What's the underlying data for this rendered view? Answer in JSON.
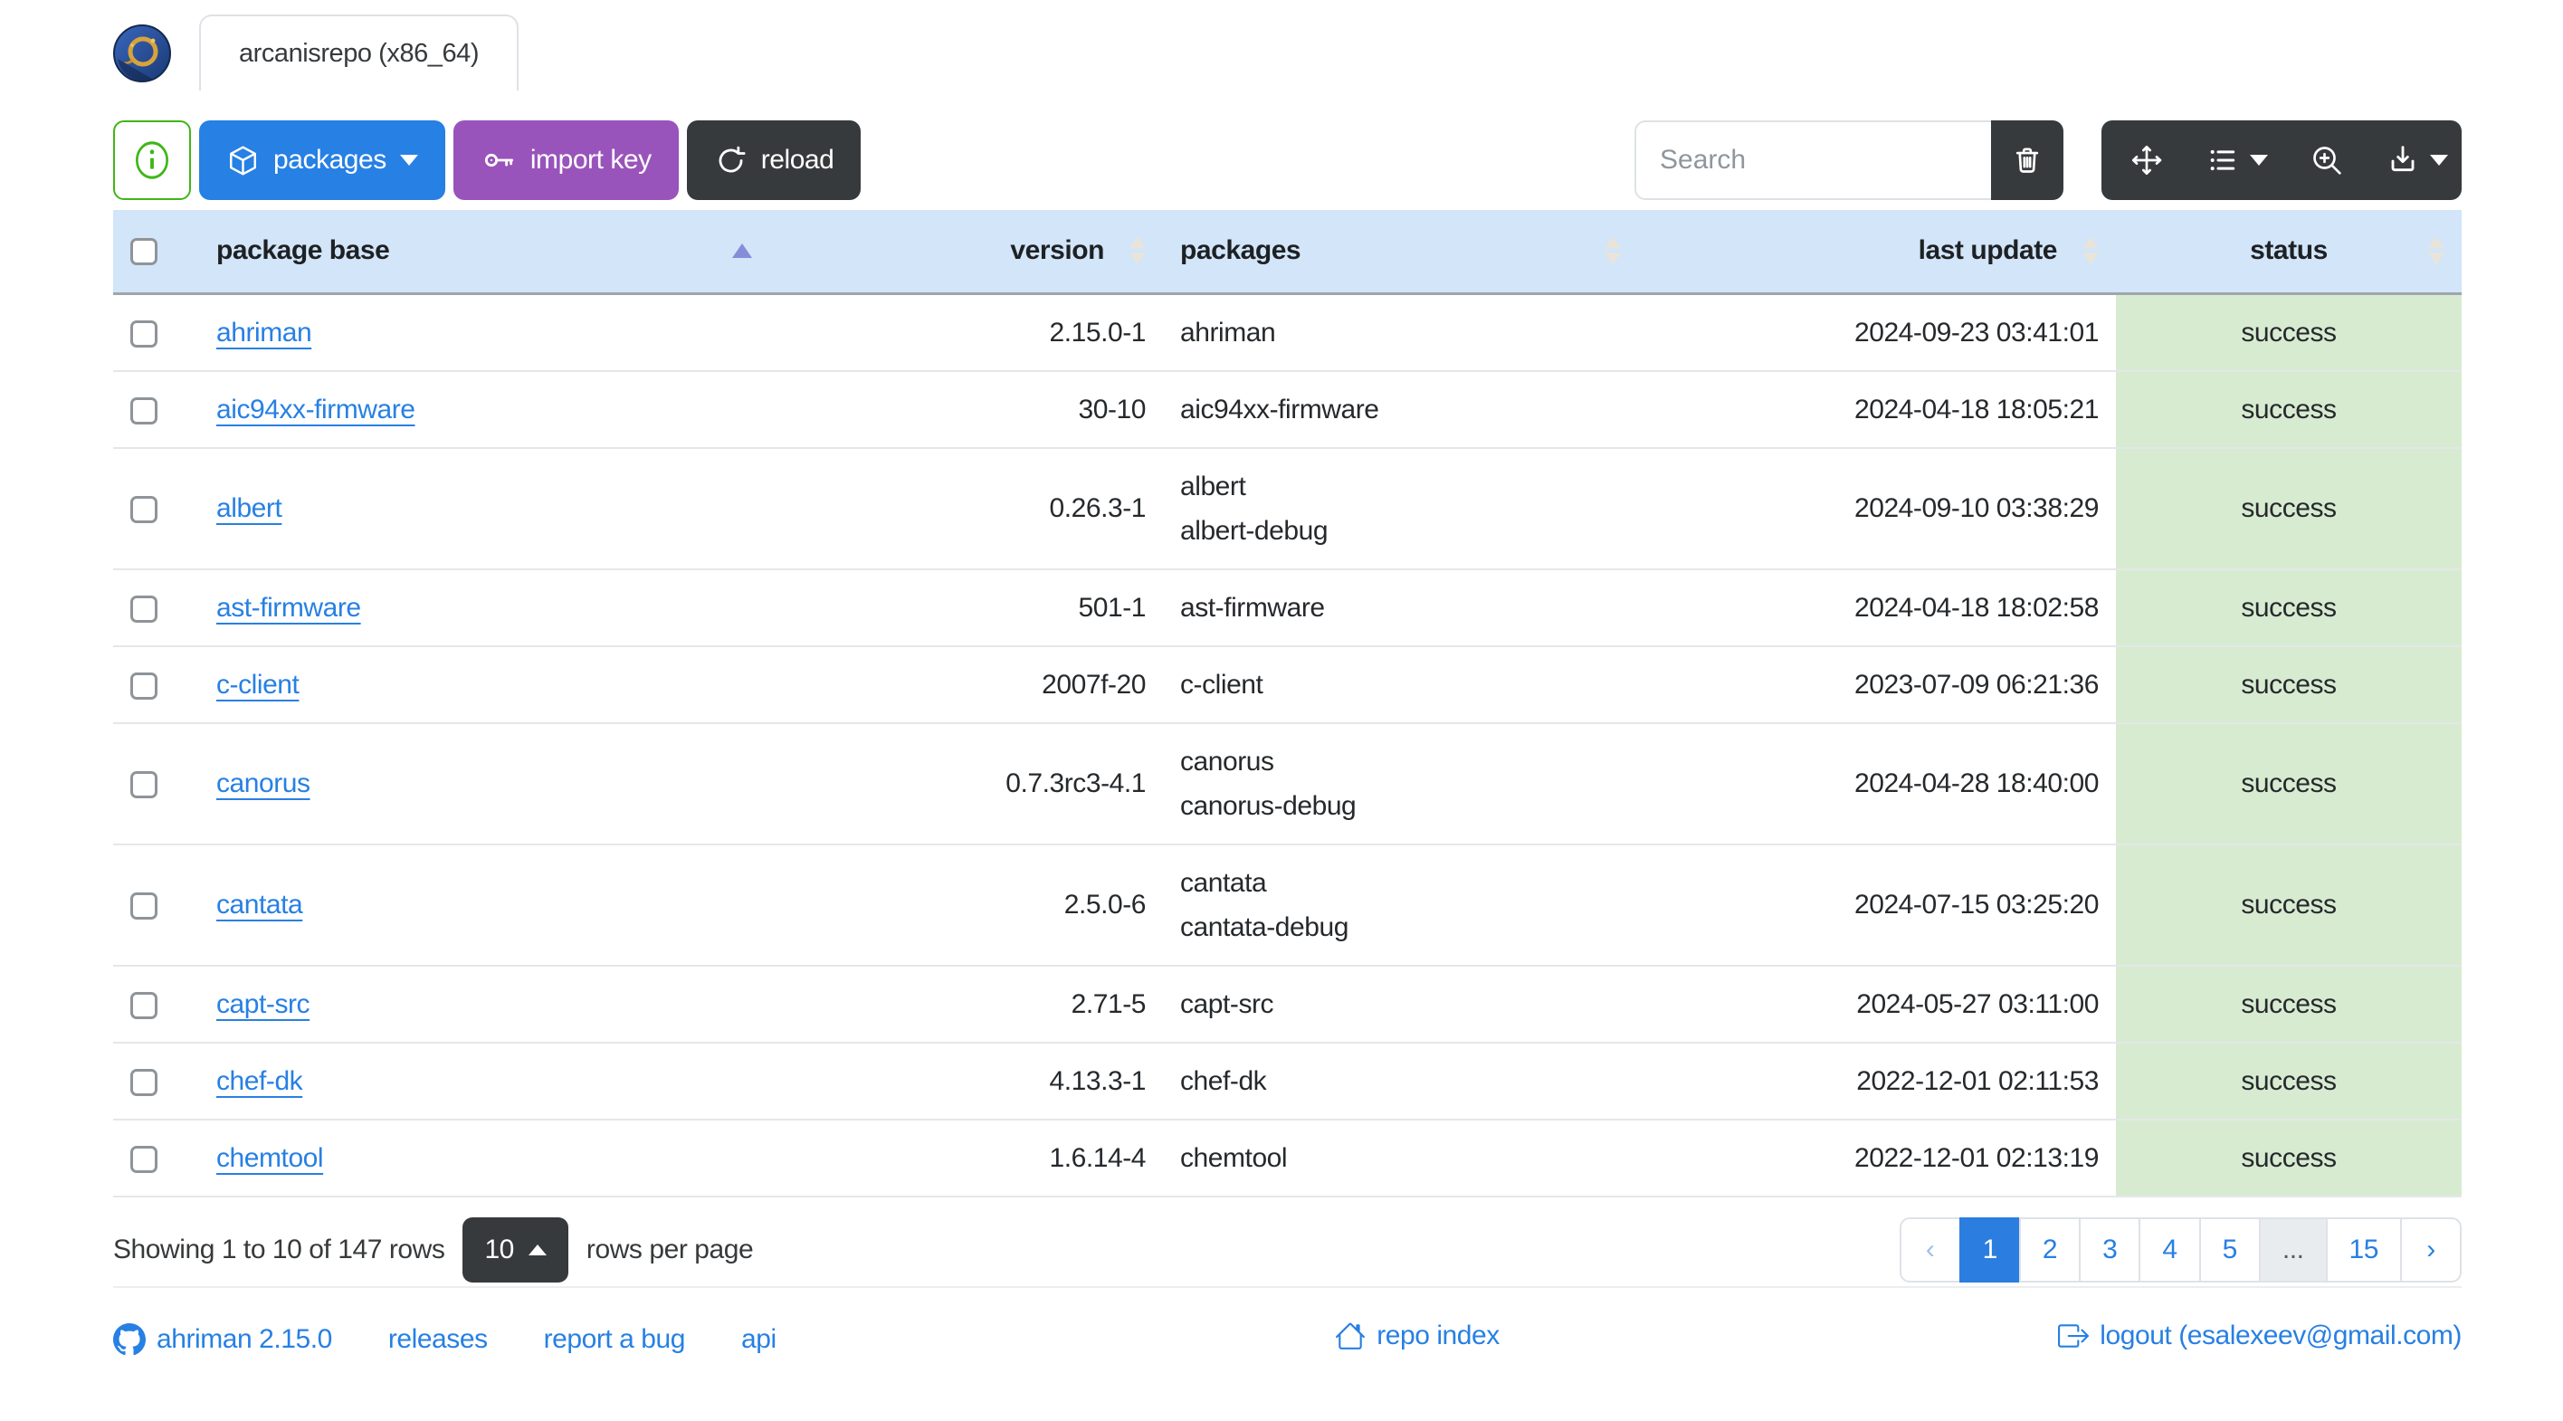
{
  "window": {
    "tab_title": "arcanisrepo (x86_64)",
    "logo": "ahriman-repository-logo"
  },
  "toolbar": {
    "info_button_icon": "info-circle-icon",
    "packages_label": "packages",
    "import_key_label": "import key",
    "reload_label": "reload",
    "search_placeholder": "Search",
    "icons": [
      "package-box-icon",
      "key-icon",
      "reload-icon",
      "trash-icon",
      "arrows-move-icon",
      "list-columns-icon",
      "zoom-in-icon",
      "download-icon"
    ]
  },
  "table": {
    "columns": [
      "package base",
      "version",
      "packages",
      "last update",
      "status"
    ],
    "sort": {
      "column": "package base",
      "direction": "asc"
    },
    "rows": [
      {
        "base": "ahriman",
        "version": "2.15.0-1",
        "packages": [
          "ahriman"
        ],
        "last_update": "2024-09-23 03:41:01",
        "status": "success"
      },
      {
        "base": "aic94xx-firmware",
        "version": "30-10",
        "packages": [
          "aic94xx-firmware"
        ],
        "last_update": "2024-04-18 18:05:21",
        "status": "success"
      },
      {
        "base": "albert",
        "version": "0.26.3-1",
        "packages": [
          "albert",
          "albert-debug"
        ],
        "last_update": "2024-09-10 03:38:29",
        "status": "success"
      },
      {
        "base": "ast-firmware",
        "version": "501-1",
        "packages": [
          "ast-firmware"
        ],
        "last_update": "2024-04-18 18:02:58",
        "status": "success"
      },
      {
        "base": "c-client",
        "version": "2007f-20",
        "packages": [
          "c-client"
        ],
        "last_update": "2023-07-09 06:21:36",
        "status": "success"
      },
      {
        "base": "canorus",
        "version": "0.7.3rc3-4.1",
        "packages": [
          "canorus",
          "canorus-debug"
        ],
        "last_update": "2024-04-28 18:40:00",
        "status": "success"
      },
      {
        "base": "cantata",
        "version": "2.5.0-6",
        "packages": [
          "cantata",
          "cantata-debug"
        ],
        "last_update": "2024-07-15 03:25:20",
        "status": "success"
      },
      {
        "base": "capt-src",
        "version": "2.71-5",
        "packages": [
          "capt-src"
        ],
        "last_update": "2024-05-27 03:11:00",
        "status": "success"
      },
      {
        "base": "chef-dk",
        "version": "4.13.3-1",
        "packages": [
          "chef-dk"
        ],
        "last_update": "2022-12-01 02:11:53",
        "status": "success"
      },
      {
        "base": "chemtool",
        "version": "1.6.14-4",
        "packages": [
          "chemtool"
        ],
        "last_update": "2022-12-01 02:13:19",
        "status": "success"
      }
    ]
  },
  "pagination": {
    "summary": "Showing 1 to 10 of 147 rows",
    "page_size": "10",
    "rows_per_page_label": "rows per page",
    "items": [
      {
        "label": "‹",
        "kind": "prev"
      },
      {
        "label": "1",
        "kind": "page",
        "active": true
      },
      {
        "label": "2",
        "kind": "page"
      },
      {
        "label": "3",
        "kind": "page"
      },
      {
        "label": "4",
        "kind": "page"
      },
      {
        "label": "5",
        "kind": "page"
      },
      {
        "label": "...",
        "kind": "ellipsis"
      },
      {
        "label": "15",
        "kind": "page"
      },
      {
        "label": "›",
        "kind": "next"
      }
    ]
  },
  "footer": {
    "version_link": "ahriman 2.15.0",
    "releases_link": "releases",
    "report_bug_link": "report a bug",
    "api_link": "api",
    "repo_index_link": "repo index",
    "logout_link": "logout (esalexeev@gmail.com)",
    "icons": [
      "github-icon",
      "home-icon",
      "logout-icon"
    ]
  },
  "colors": {
    "primary_blue": "#2780e3",
    "info_purple": "#9954bb",
    "secondary_dark": "#373a3c",
    "success_green": "#3fb618",
    "table_header_bg": "#d2e5f9",
    "status_success_bg": "#d7ebd1",
    "sort_asc_caret": "#858cd8"
  }
}
